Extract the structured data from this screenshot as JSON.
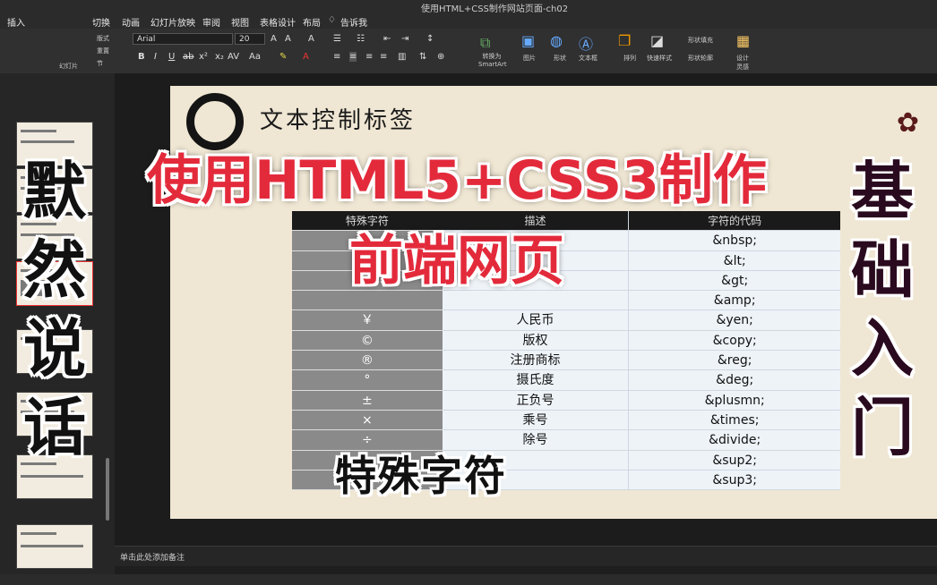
{
  "app": {
    "doc_title": "使用HTML+CSS制作网站页面-ch02",
    "menu_tabs": [
      "插入",
      "切换",
      "动画",
      "幻灯片放映",
      "审阅",
      "视图",
      "表格设计",
      "布局",
      "告诉我"
    ]
  },
  "ribbon": {
    "font_name": "Arial",
    "font_size": "20",
    "labels": {
      "convert_smartart": "转换为 SmartArt",
      "picture": "图片",
      "shape": "形状",
      "textbox": "文本框",
      "arrange": "排列",
      "quick_styles": "快速样式",
      "shape_fill": "形状填充",
      "shape_outline": "形状轮廓",
      "designer": "设计 灵感",
      "layout": "版式",
      "reset": "重置",
      "section": "节",
      "slide": "幻灯片"
    }
  },
  "slide": {
    "title": "文本控制标签",
    "table": {
      "headers": [
        "特殊字符",
        "描述",
        "字符的代码"
      ],
      "rows": [
        [
          "",
          "",
          "&nbsp;"
        ],
        [
          "",
          "",
          "&lt;"
        ],
        [
          "",
          "",
          "&gt;"
        ],
        [
          "",
          "",
          "&amp;"
        ],
        [
          "￥",
          "人民币",
          "&yen;"
        ],
        [
          "©",
          "版权",
          "&copy;"
        ],
        [
          "®",
          "注册商标",
          "&reg;"
        ],
        [
          "°",
          "摄氏度",
          "&deg;"
        ],
        [
          "±",
          "正负号",
          "&plusmn;"
        ],
        [
          "×",
          "乘号",
          "&times;"
        ],
        [
          "÷",
          "除号",
          "&divide;"
        ],
        [
          "",
          "",
          "&sup2;"
        ],
        [
          "",
          "",
          "&sup3;"
        ]
      ]
    }
  },
  "notes_placeholder": "单击此处添加备注",
  "overlay": {
    "title_line1": "使用HTML5+CSS3制作",
    "title_line2": "前端网页",
    "left_vertical": [
      "默",
      "然",
      "说",
      "话"
    ],
    "right_vertical": [
      "基",
      "础",
      "入",
      "门"
    ],
    "bottom_text": "特殊字符"
  },
  "colors": {
    "overlay_red": "#e32a3b",
    "slide_bg": "#efe6d3"
  }
}
